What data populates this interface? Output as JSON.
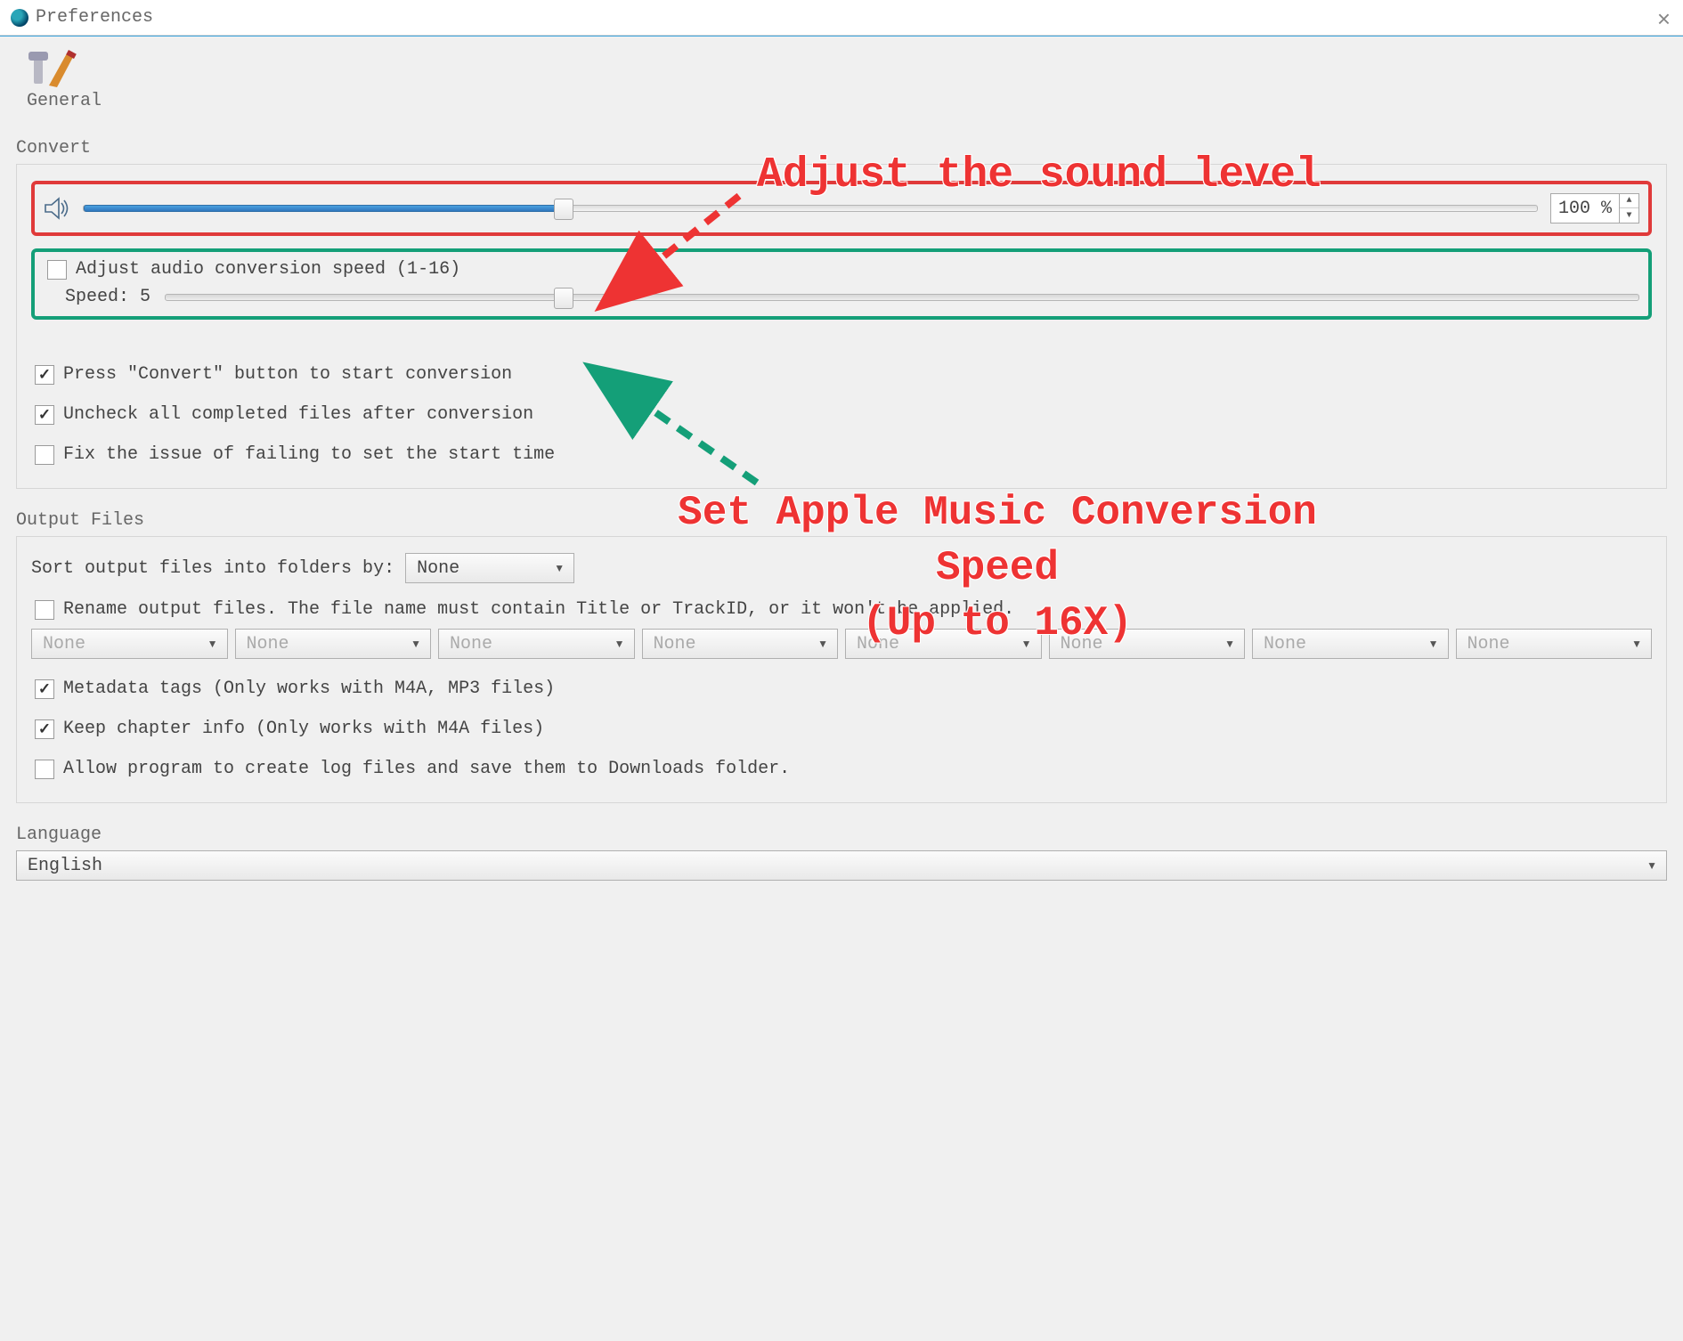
{
  "window": {
    "title": "Preferences"
  },
  "toolbar": {
    "general_label": "General"
  },
  "annotations": {
    "sound_level": "Adjust the sound level",
    "conversion_speed_l1": "Set Apple Music Conversion Speed",
    "conversion_speed_l2": "(Up to 16X)"
  },
  "convert": {
    "section_label": "Convert",
    "volume_percent": "100 %",
    "volume_fill_pct": 33,
    "adjust_speed_label": "Adjust audio conversion speed (1-16)",
    "adjust_speed_checked": false,
    "speed_prefix": "Speed:",
    "speed_value": "5",
    "speed_thumb_pct": 27,
    "press_convert_label": "Press \"Convert\" button to start conversion",
    "press_convert_checked": true,
    "uncheck_completed_label": "Uncheck all completed files after conversion",
    "uncheck_completed_checked": true,
    "fix_start_time_label": "Fix the issue of failing to set the start time",
    "fix_start_time_checked": false
  },
  "output": {
    "section_label": "Output Files",
    "sort_label": "Sort output files into folders by:",
    "sort_value": "None",
    "rename_label": "Rename output files. The file name must contain Title or TrackID, or it won't be applied.",
    "rename_checked": false,
    "rename_combo_value": "None",
    "metadata_label": "Metadata tags (Only works with M4A, MP3 files)",
    "metadata_checked": true,
    "chapter_label": "Keep chapter info (Only works with M4A files)",
    "chapter_checked": true,
    "log_label": "Allow program to create log files and save them to Downloads folder.",
    "log_checked": false
  },
  "language": {
    "section_label": "Language",
    "value": "English"
  }
}
